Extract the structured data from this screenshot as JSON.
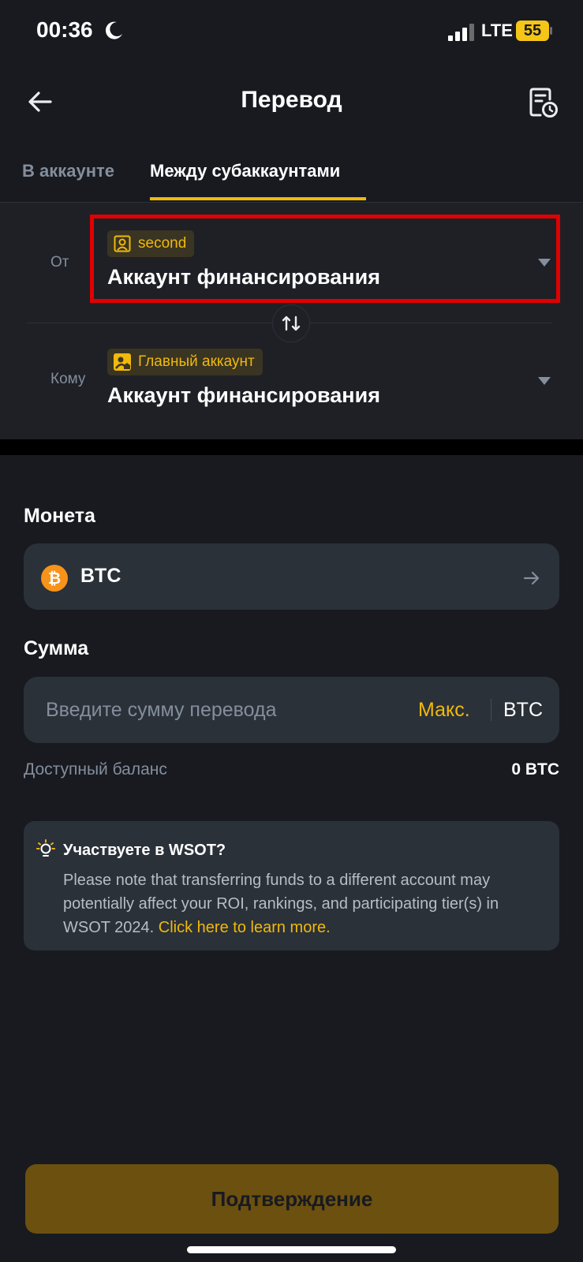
{
  "status_bar": {
    "time": "00:36",
    "network": "LTE",
    "battery": "55",
    "icons": [
      "moon-icon",
      "signal-bars-icon",
      "battery-icon"
    ]
  },
  "header": {
    "title": "Перевод",
    "icons": [
      "back-arrow-icon",
      "history-document-icon"
    ]
  },
  "tabs": [
    {
      "label": "В аккаунте",
      "active": false
    },
    {
      "label": "Между субаккаунтами",
      "active": true
    }
  ],
  "transfer": {
    "from": {
      "label": "От",
      "tag": "second",
      "account": "Аккаунт финансирования"
    },
    "to": {
      "label": "Кому",
      "tag": "Главный аккаунт",
      "account": "Аккаунт финансирования"
    },
    "swap_icon": "swap-arrows-icon"
  },
  "coin": {
    "label": "Монета",
    "symbol": "BTC",
    "icon": "bitcoin-icon"
  },
  "amount": {
    "label": "Сумма",
    "placeholder": "Введите сумму перевода",
    "max_label": "Макс.",
    "unit": "BTC",
    "balance_label": "Доступный баланс",
    "balance_value": "0 BTC"
  },
  "notice": {
    "title": "Участвуете в WSOT?",
    "body": "Please note that transferring funds to a different account may potentially affect your ROI, rankings, and participating tier(s) in WSOT 2024. ",
    "link": "Click here to learn more."
  },
  "confirm_label": "Подтверждение",
  "colors": {
    "background": "#181a20",
    "card": "#1e2026",
    "field": "#2b3139",
    "accent": "#f0b90b",
    "confirm": "#6b500f",
    "highlight": "#e00000"
  }
}
